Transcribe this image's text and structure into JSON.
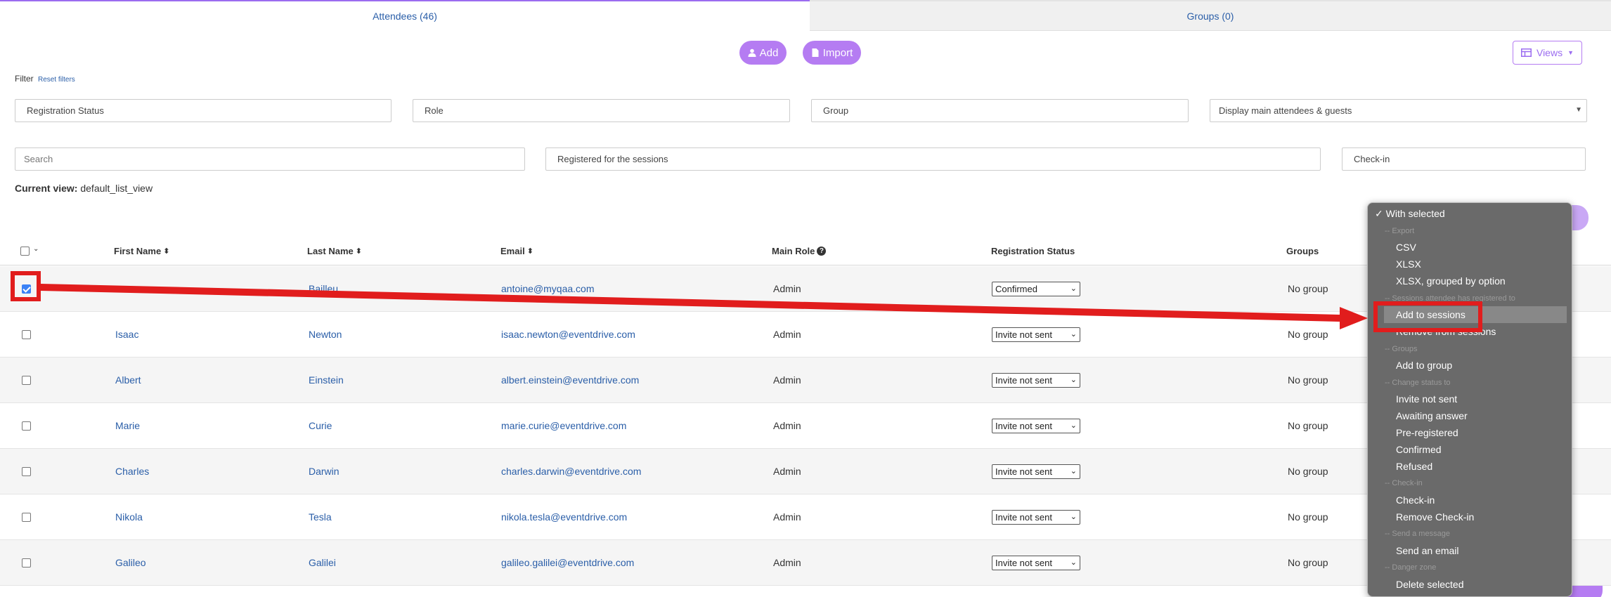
{
  "tabs": [
    {
      "label": "Attendees (46)"
    },
    {
      "label": "Groups (0)"
    }
  ],
  "toolbar": {
    "add_label": "Add",
    "import_label": "Import",
    "views_label": "Views"
  },
  "filter": {
    "label": "Filter",
    "reset_label": "Reset filters"
  },
  "filters": {
    "registration_status": "Registration Status",
    "role": "Role",
    "group": "Group",
    "display_mode": "Display main attendees & guests",
    "search_placeholder": "Search",
    "sessions": "Registered for the sessions",
    "checkin": "Check-in"
  },
  "current_view": {
    "label": "Current view:",
    "value": "default_list_view"
  },
  "table": {
    "headers": {
      "first_name": "First Name",
      "last_name": "Last Name",
      "email": "Email",
      "main_role": "Main Role",
      "registration_status": "Registration Status",
      "groups": "Groups"
    },
    "rows": [
      {
        "first": "",
        "last": "Bailleu",
        "email": "antoine@myqaa.com",
        "role": "Admin",
        "status": "Confirmed",
        "group": "No group",
        "checked": true
      },
      {
        "first": "Isaac",
        "last": "Newton",
        "email": "isaac.newton@eventdrive.com",
        "role": "Admin",
        "status": "Invite not sent",
        "group": "No group",
        "checked": false
      },
      {
        "first": "Albert",
        "last": "Einstein",
        "email": "albert.einstein@eventdrive.com",
        "role": "Admin",
        "status": "Invite not sent",
        "group": "No group",
        "checked": false
      },
      {
        "first": "Marie",
        "last": "Curie",
        "email": "marie.curie@eventdrive.com",
        "role": "Admin",
        "status": "Invite not sent",
        "group": "No group",
        "checked": false
      },
      {
        "first": "Charles",
        "last": "Darwin",
        "email": "charles.darwin@eventdrive.com",
        "role": "Admin",
        "status": "Invite not sent",
        "group": "No group",
        "checked": false
      },
      {
        "first": "Nikola",
        "last": "Tesla",
        "email": "nikola.tesla@eventdrive.com",
        "role": "Admin",
        "status": "Invite not sent",
        "group": "No group",
        "checked": false
      },
      {
        "first": "Galileo",
        "last": "Galilei",
        "email": "galileo.galilei@eventdrive.com",
        "role": "Admin",
        "status": "Invite not sent",
        "group": "No group",
        "checked": false
      }
    ]
  },
  "menu": {
    "title": "✓ With selected",
    "export_header": "-- Export",
    "csv": "CSV",
    "xlsx": "XLSX",
    "xlsx_grouped": "XLSX, grouped by option",
    "sessions_header": "-- Sessions attendee has registered to",
    "add_to_sessions": "Add to sessions",
    "remove_from_sessions": "Remove from sessions",
    "groups_header": "-- Groups",
    "add_to_group": "Add to group",
    "status_header": "-- Change status to",
    "invite_not_sent": "Invite not sent",
    "awaiting_answer": "Awaiting answer",
    "pre_registered": "Pre-registered",
    "confirmed": "Confirmed",
    "refused": "Refused",
    "checkin_header": "-- Check-in",
    "checkin": "Check-in",
    "remove_checkin": "Remove Check-in",
    "message_header": "-- Send a message",
    "send_email": "Send an email",
    "danger_header": "-- Danger zone",
    "delete_selected": "Delete selected"
  },
  "colors": {
    "accent": "#b57cf2",
    "link": "#2a5ea8",
    "annotation": "#e11d1d",
    "menu_bg": "#6a6a6a"
  }
}
